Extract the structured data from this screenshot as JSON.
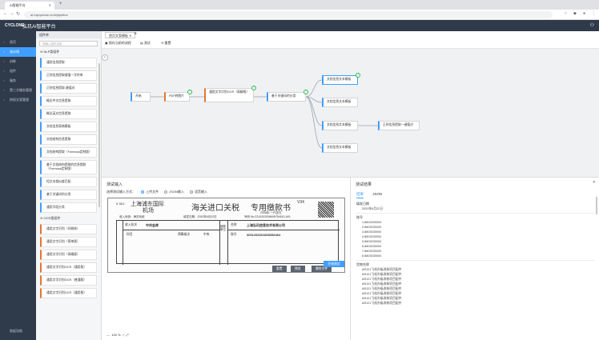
{
  "browser": {
    "tab_title": "AI智能平台",
    "url": "ai.mycyclone.cn/#/pipeline"
  },
  "app": {
    "logo": "CYCLONE",
    "title": "弘玑AI智能平台"
  },
  "leftnav": {
    "items": [
      {
        "label": "首页",
        "active": false
      },
      {
        "label": "流水线",
        "active": true
      },
      {
        "label": "训练",
        "active": false
      },
      {
        "label": "组件",
        "active": false
      },
      {
        "label": "服务",
        "active": false
      },
      {
        "label": "第三方服务管理",
        "active": false
      },
      {
        "label": "授权文案管理",
        "active": false
      }
    ],
    "bottom": "收起导航"
  },
  "components": {
    "title": "组件库",
    "search_placeholder": "请输入组件名称",
    "nlp_group": "NLP类组件",
    "nlp_items": [
      "通用信息提取",
      "正则信息提取键值一字符串",
      "正则信息提取-键值对",
      "概念中文信息提取",
      "概念英文信息提取",
      "文档信息表格模板",
      "文档结构信息提取",
      "文档结构提取（Formosa定制版）",
      "基于文档结构提取的信息提取（Formosa定制版）",
      "短文本相似度匹配",
      "基于关键词的分类",
      "通用字段分类"
    ],
    "ocr_group": "OCR类组件",
    "ocr_items": [
      "通用文字识别（印刷体）",
      "通用文字识别（简单版）",
      "通用文字识别（高精版）",
      "通用文字识别OCR（通用版）",
      "通用文字识别OCR（普通版）",
      "通用文字识别OCR（通用版）"
    ]
  },
  "workspace": {
    "tab": "首页文案模板",
    "toolbar": [
      "保存当前的流程",
      "测试",
      "重置"
    ]
  },
  "flow": {
    "nodes": [
      "开始",
      "PDF转图片",
      "通用文字识别OCR（高精版）",
      "基于关键词的分类",
      "文档信息文本模板",
      "文档信息文本模板",
      "文档信息文本模板",
      "正则信息提取一键值对",
      "文档信息文本模板"
    ]
  },
  "test_input": {
    "title": "测试输入",
    "mode_label": "选择测试输入方式：",
    "modes": [
      "上传文件",
      "JSON输入",
      "语音输入"
    ],
    "preview_buttons": [
      "重置",
      "预览",
      "删除文件"
    ],
    "run": "开始测试",
    "zoom": "100 %"
  },
  "receipt": {
    "code": "K 501",
    "line1": "上海浦东国际",
    "line1b": "海关进口关税",
    "title": "专用缴款书",
    "stamp": "V34",
    "org": "收入系统：海关系统",
    "date": "填发日期：2020年6月22日",
    "ref": "号码 No.2210202006606754610-A01",
    "line2": "机场",
    "year": "2006年-一代支付",
    "payee_org": "中央金库",
    "payer": "上海弘玑信息技术有限公司",
    "account": "3001252601865356464",
    "row_a": "收入机关",
    "row_b": "科目",
    "row_c": "预算级次",
    "row_d": "中央",
    "row_e": "名称",
    "row_f": "账号",
    "row_g": "缴款单位"
  },
  "test_result": {
    "title": "测试结果",
    "tabs": [
      "结果",
      "JSON"
    ],
    "fill_date_label": "填发日期",
    "fill_date": "2020年6月22日",
    "account_label": "账号",
    "accounts": [
      "1.8803030000",
      "2.8803030000",
      "3.8803030000",
      "4.8803030000",
      "5.8803030000",
      "6.8803030000",
      "7.8803030000",
      "8.8803030000"
    ],
    "goods_label": "货物名称",
    "goods": [
      "ARJ21飞机升级改装项目配件",
      "ARJ21飞机升级改装项目配件",
      "ARJ21飞机升级改装项目配件",
      "ARJ21飞机升级改装项目配件",
      "ARJ21飞机升级改装项目配件",
      "ARJ21飞机升级改装项目配件",
      "ARJ21飞机升级改装项目配件",
      "ARJ21飞机升级改装项目配件"
    ]
  }
}
